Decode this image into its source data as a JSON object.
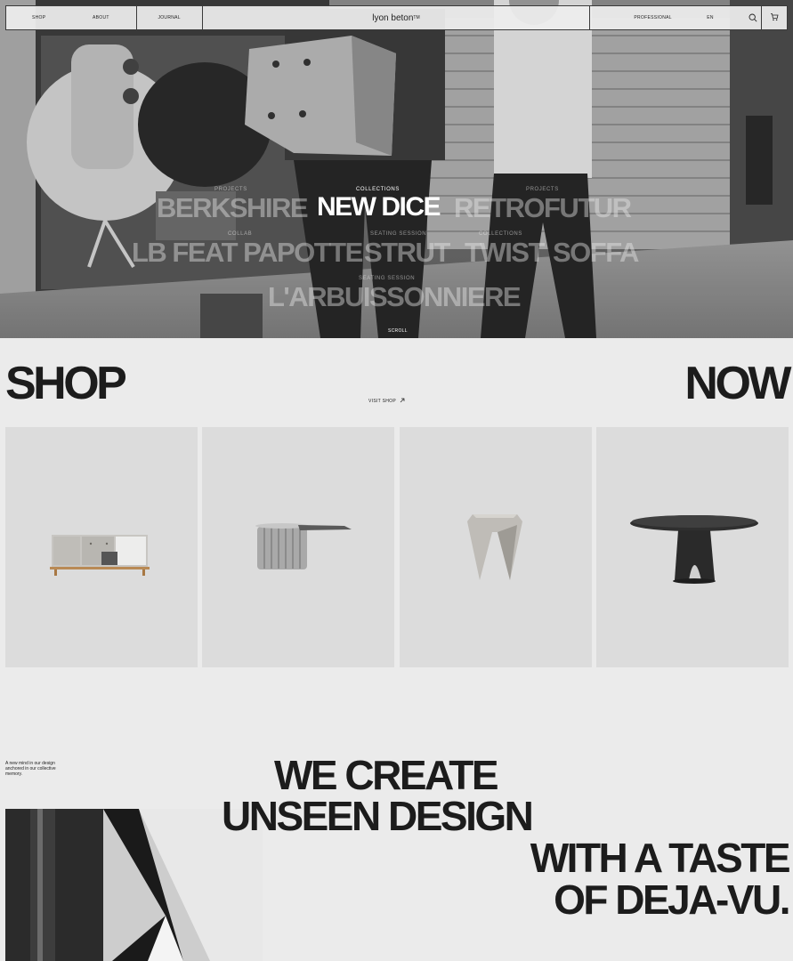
{
  "nav": {
    "shop": "SHOP",
    "about": "ABOUT",
    "journal": "JOURNAL",
    "brand": "lyon beton",
    "brand_mark": "TM",
    "professional": "PROFESSIONAL",
    "language": "EN",
    "search_icon": "search-icon",
    "cart_icon": "cart-icon"
  },
  "hero": {
    "menu": [
      {
        "category": "PROJECTS",
        "name": "BERKSHIRE"
      },
      {
        "category": "COLLECTIONS",
        "name": "NEW DICE",
        "active": true
      },
      {
        "category": "PROJECTS",
        "name": "RETROFUTUR"
      },
      {
        "category": "COLLAB",
        "name": "LB FEAT PAPOTTE"
      },
      {
        "category": "SEATING SESSION",
        "name": "STRUT"
      },
      {
        "category": "COLLECTIONS",
        "name": "TWIST"
      },
      {
        "name": "SOFFA"
      },
      {
        "category": "SEATING SESSION",
        "name": "L'ARBUISSONNIERE"
      }
    ],
    "scroll": "SCROLL"
  },
  "shop": {
    "heading_left": "SHOP",
    "heading_right": "NOW",
    "visit_label": "VISIT SHOP",
    "visit_icon": "arrow-up-right-icon",
    "products": [
      {
        "kind": "sideboard"
      },
      {
        "kind": "pedestal side table"
      },
      {
        "kind": "stool"
      },
      {
        "kind": "oval table"
      }
    ]
  },
  "manifesto": {
    "note": "A new mind in our design anchored in our collective memory.",
    "line1": "WE CREATE",
    "line2": "UNSEEN DESIGN",
    "line3": "WITH A TASTE",
    "line4": "OF DEJA-VU."
  },
  "colors": {
    "background": "#ebebeb",
    "text": "#1c1c1c",
    "card": "#dcdcdc"
  }
}
